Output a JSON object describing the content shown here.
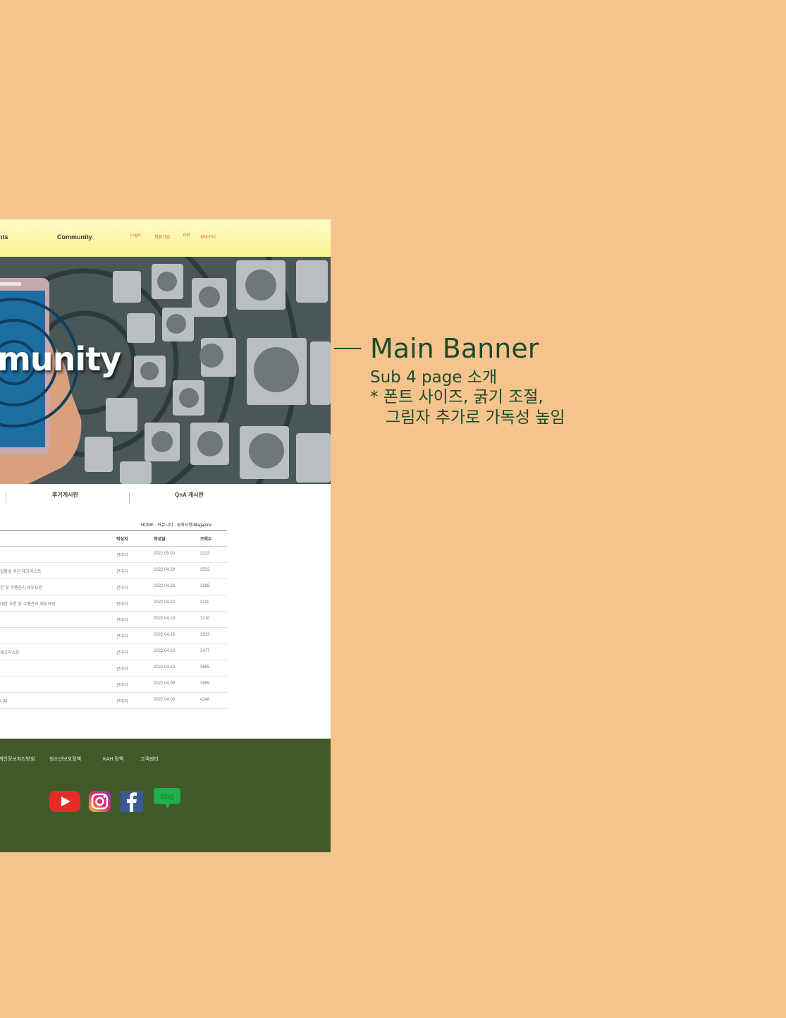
{
  "header": {
    "nav": [
      "nts",
      "Community"
    ],
    "util_links": [
      "Login",
      "회원가입",
      "DM",
      "장바구니"
    ]
  },
  "banner": {
    "title": "munity"
  },
  "tabs": [
    "후기게시판",
    "QnA 게시판"
  ],
  "breadcrumb": "HOME · 커뮤니티 · 공지사항/Magazine",
  "board": {
    "columns": [
      "",
      "작성자",
      "작성일",
      "조회수"
    ],
    "rows": [
      {
        "title": "",
        "author": "관리자",
        "date": "2022.05.03",
        "views": "2222"
      },
      {
        "title": "일활성 추천 체크리스트",
        "author": "관리자",
        "date": "2022.04.29",
        "views": "2522"
      },
      {
        "title": "천 및 수행관리 세부요령",
        "author": "관리자",
        "date": "2022.04.26",
        "views": "2888"
      },
      {
        "title": "대한 추천 및 수행관리 세부요령",
        "author": "관리자",
        "date": "2022.04.22",
        "views": "3111"
      },
      {
        "title": "",
        "author": "관리자",
        "date": "2022.04.19",
        "views": "3210"
      },
      {
        "title": "",
        "author": "관리자",
        "date": "2022.04.16",
        "views": "3333"
      },
      {
        "title": "체크리스트",
        "author": "관리자",
        "date": "2022.04.13",
        "views": "3477"
      },
      {
        "title": "",
        "author": "관리자",
        "date": "2022.04.10",
        "views": "3655"
      },
      {
        "title": "",
        "author": "관리자",
        "date": "2022.04.09",
        "views": "3999"
      },
      {
        "title": "니다",
        "author": "관리자",
        "date": "2022.04.03",
        "views": "4248"
      }
    ]
  },
  "footer": {
    "links": [
      "개인정보처리방침",
      "청소년보호정책",
      "KAH 정책",
      "고객센터"
    ],
    "social_icons": [
      "youtube-icon",
      "instagram-icon",
      "facebook-icon",
      "blog-icon"
    ],
    "blog_label": "blog"
  },
  "annotation": {
    "title": "Main Banner",
    "lines": [
      "Sub 4 page 소개",
      "* 폰트 사이즈, 굵기 조절,",
      "   그림자 추가로 가독성 높임"
    ]
  },
  "colors": {
    "background": "#F7C38C",
    "header": "#FBF48F",
    "footer": "#425A29",
    "annotation": "#1C4A2C"
  }
}
